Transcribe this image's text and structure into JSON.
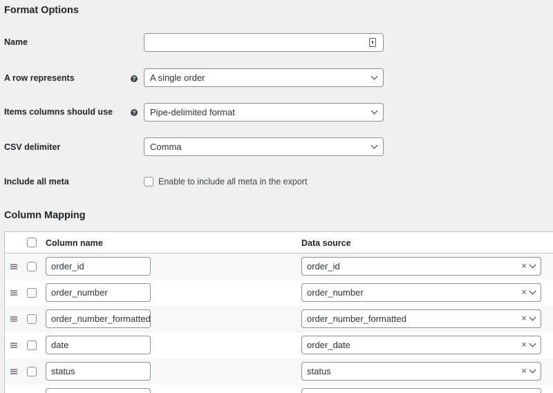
{
  "format_options": {
    "heading": "Format Options",
    "name_label": "Name",
    "name_value": "",
    "row_label": "A row represents",
    "row_value": "A single order",
    "items_label": "Items columns should use",
    "items_value": "Pipe-delimited format",
    "csv_label": "CSV delimiter",
    "csv_value": "Comma",
    "meta_label": "Include all meta",
    "meta_checkbox_label": "Enable to include all meta in the export"
  },
  "column_mapping": {
    "heading": "Column Mapping",
    "col_name_header": "Column name",
    "data_source_header": "Data source",
    "rows": [
      {
        "column": "order_id",
        "source": "order_id"
      },
      {
        "column": "order_number",
        "source": "order_number"
      },
      {
        "column": "order_number_formatted",
        "source": "order_number_formatted"
      },
      {
        "column": "date",
        "source": "order_date"
      },
      {
        "column": "status",
        "source": "status"
      }
    ]
  },
  "icons": {
    "help": "?",
    "clear": "×"
  }
}
